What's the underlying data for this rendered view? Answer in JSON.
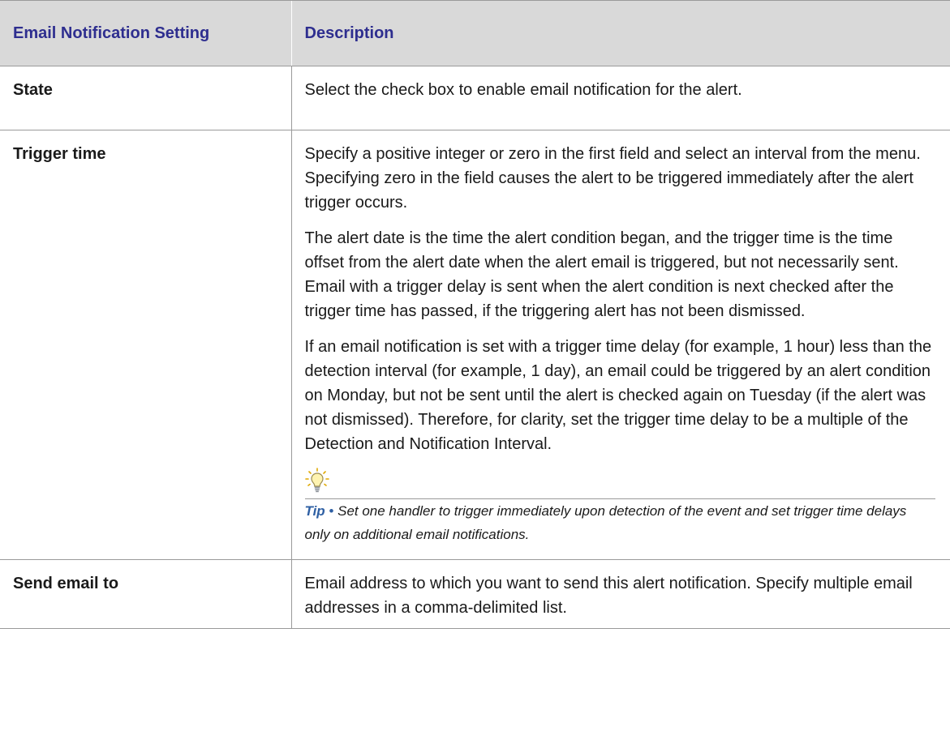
{
  "table": {
    "headers": {
      "setting": "Email Notification Setting",
      "description": "Description"
    },
    "rows": [
      {
        "name": "State",
        "paragraphs": [
          "Select the check box to enable email notification for the alert."
        ]
      },
      {
        "name": "Trigger time",
        "paragraphs": [
          "Specify a positive integer or zero in the first field and select an interval from the menu. Specifying zero in the field causes the alert to be triggered immediately after the alert trigger occurs.",
          "The alert date is the time the alert condition began, and the trigger time is the time offset from the alert date when the alert email is triggered, but not necessarily sent. Email with a trigger delay is sent when the alert condition is next checked after the trigger time has passed, if the triggering alert has not been dismissed.",
          "If an email notification is set with a trigger time delay (for example, 1 hour) less than the detection interval (for example, 1 day), an email could be triggered by an alert condition on Monday, but not be sent until the alert is checked again on Tuesday (if the alert was not dismissed). Therefore, for clarity, set the trigger time delay to be a multiple of the Detection and Notification Interval."
        ],
        "tip": {
          "icon": "lightbulb-icon",
          "label": "Tip",
          "bullet": "•",
          "text": "Set one handler to trigger immediately upon detection of the event and set trigger time delays only on additional email notifications."
        }
      },
      {
        "name": "Send email to",
        "paragraphs": [
          "Email address to which you want to send this alert notification. Specify multiple email addresses in a comma-delimited list."
        ]
      }
    ]
  },
  "colors": {
    "header_background": "#d9d9d9",
    "header_text": "#2e2e8f",
    "tip_accent": "#2e5fa3",
    "rule": "#9a9a9a"
  }
}
